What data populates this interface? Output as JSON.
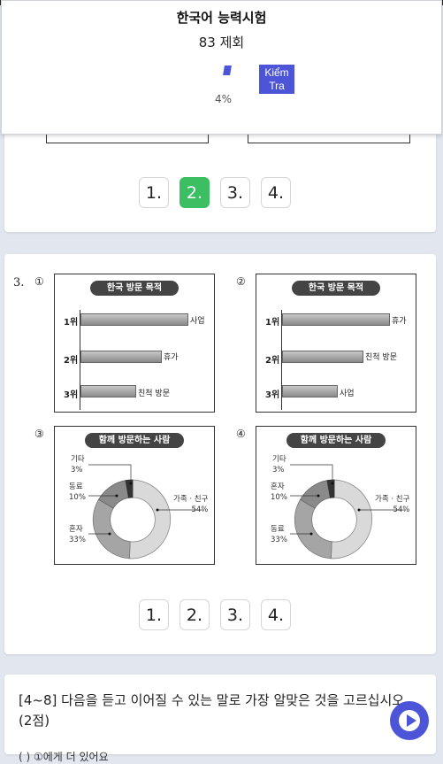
{
  "header": {
    "title": "한국어 능력시험",
    "subtitle": "83 제회",
    "progress_percent": 4,
    "progress_label": "4%",
    "check_button": "Kiểm Tra"
  },
  "question2": {
    "options": [
      "1.",
      "2.",
      "3.",
      "4."
    ],
    "selected": "2."
  },
  "question3": {
    "number": "3.",
    "options": [
      "1.",
      "2.",
      "3.",
      "4."
    ],
    "panels": [
      {
        "marker": "①",
        "title": "한국 방문 목적",
        "rows": [
          {
            "rank": "1위",
            "label": "사업",
            "value": 3
          },
          {
            "rank": "2위",
            "label": "휴가",
            "value": 2
          },
          {
            "rank": "3위",
            "label": "친척 방문",
            "value": 1
          }
        ]
      },
      {
        "marker": "②",
        "title": "한국 방문 목적",
        "rows": [
          {
            "rank": "1위",
            "label": "휴가",
            "value": 3
          },
          {
            "rank": "2위",
            "label": "친척 방문",
            "value": 2
          },
          {
            "rank": "3위",
            "label": "사업",
            "value": 1
          }
        ]
      },
      {
        "marker": "③",
        "title": "함께 방문하는 사람",
        "slices": [
          {
            "label": "기타",
            "value_text": "3%",
            "value": 3
          },
          {
            "label": "동료",
            "value_text": "10%",
            "value": 10
          },
          {
            "label": "혼자",
            "value_text": "33%",
            "value": 33
          },
          {
            "label": "가족 · 친구",
            "value_text": "54%",
            "value": 54
          }
        ]
      },
      {
        "marker": "④",
        "title": "함께 방문하는 사람",
        "slices": [
          {
            "label": "기타",
            "value_text": "3%",
            "value": 3
          },
          {
            "label": "혼자",
            "value_text": "10%",
            "value": 10
          },
          {
            "label": "동료",
            "value_text": "33%",
            "value": 33
          },
          {
            "label": "가족 · 친구",
            "value_text": "54%",
            "value": 54
          }
        ]
      }
    ]
  },
  "question4": {
    "instruction": "[4~8] 다음을 듣고 이어질 수 있는 말로 가장 알맞은 것을 고르십시오. (2점)",
    "sub_text": "(  ) ①에게 더 있어요"
  },
  "colors": {
    "accent": "#4c55d8",
    "selected": "#3cbf62"
  }
}
